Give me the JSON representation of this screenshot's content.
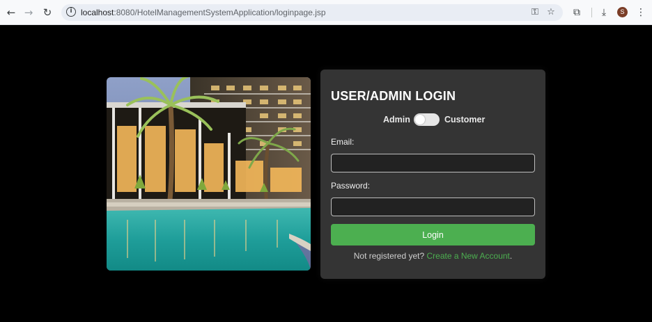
{
  "browser": {
    "url_host": "localhost",
    "url_path": ":8080/HotelManagementSystemApplication/loginpage.jsp",
    "avatar_initial": "S"
  },
  "login": {
    "title": "USER/ADMIN LOGIN",
    "toggle_left": "Admin",
    "toggle_right": "Customer",
    "toggle_state": "Admin",
    "email_label": "Email:",
    "email_value": "",
    "password_label": "Password:",
    "password_value": "",
    "login_button": "Login",
    "signup_prompt": "Not registered yet?",
    "signup_link": "Create a New Account",
    "signup_suffix": "."
  },
  "colors": {
    "accent": "#4caf50",
    "panel": "#343434",
    "page_bg": "#000000"
  }
}
